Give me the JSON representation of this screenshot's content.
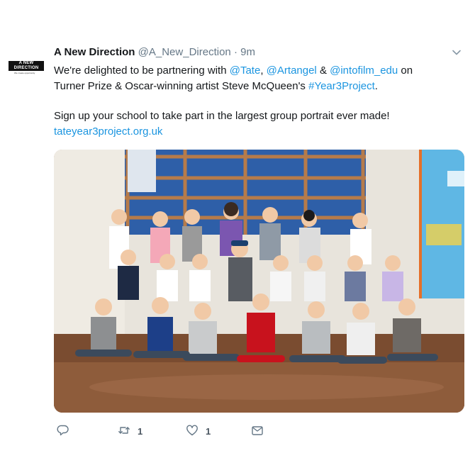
{
  "avatar": {
    "line1": "A NEW",
    "line2": "DIRECTION",
    "tagline": "We create opportunity"
  },
  "tweet": {
    "name": "A New Direction",
    "handle": "@A_New_Direction",
    "separator": "·",
    "time": "9m",
    "text": {
      "l1_pre": "We're delighted to be partnering with ",
      "mention1": "@Tate",
      "l1_comma": ", ",
      "mention2": "@Artangel",
      "l1_amp": " & ",
      "mention3": "@intofilm_edu",
      "l1_post": " on",
      "l2_pre": "Turner Prize & Oscar-winning artist Steve McQueen's ",
      "hashtag": "#Year3Project",
      "l2_post": ".",
      "l3": "Sign up your school to take part in the largest group portrait ever made!",
      "link": "tateyear3project.org.uk"
    }
  },
  "actions": {
    "reply_count": "",
    "retweet_count": "1",
    "like_count": "1"
  },
  "icons": {
    "caret": "chevron-down-icon",
    "reply": "reply-icon",
    "retweet": "retweet-icon",
    "like": "heart-icon",
    "message": "envelope-icon"
  },
  "colors": {
    "link": "#1b95e0",
    "muted": "#657786",
    "text": "#14171a"
  }
}
